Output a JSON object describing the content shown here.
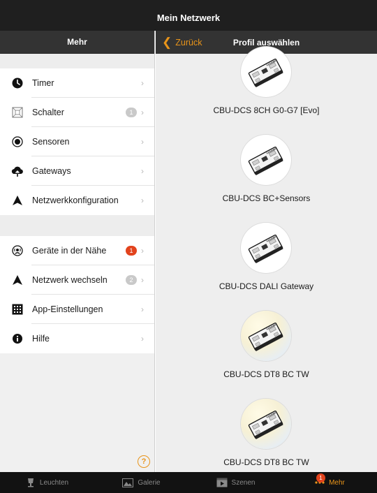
{
  "window": {
    "title": "Mein Netzwerk"
  },
  "left_panel": {
    "header": "Mehr",
    "group1": [
      {
        "label": "Timer",
        "icon": "clock-icon",
        "badge": ""
      },
      {
        "label": "Schalter",
        "icon": "switch-icon",
        "badge": "1",
        "badge_color": "#c9c9c9"
      },
      {
        "label": "Sensoren",
        "icon": "sensor-icon",
        "badge": ""
      },
      {
        "label": "Gateways",
        "icon": "cloud-upload-icon",
        "badge": ""
      },
      {
        "label": "Netzwerkkonfiguration",
        "icon": "network-arrow-icon",
        "badge": ""
      }
    ],
    "group2": [
      {
        "label": "Geräte in der Nähe",
        "icon": "nearby-icon",
        "badge": "1",
        "badge_color": "#e2431d"
      },
      {
        "label": "Netzwerk wechseln",
        "icon": "network-arrow-icon",
        "badge": "2",
        "badge_color": "#c9c9c9"
      },
      {
        "label": "App-Einstellungen",
        "icon": "settings-grid-icon",
        "badge": ""
      },
      {
        "label": "Hilfe",
        "icon": "info-icon",
        "badge": ""
      }
    ],
    "help_symbol": "?"
  },
  "right_panel": {
    "back_label": "Zurück",
    "back_symbol": "❮",
    "title": "Profil auswählen",
    "profiles": [
      {
        "name": "CBU-DCS 8CH G0-G7 [Evo]",
        "variant": "white"
      },
      {
        "name": "CBU-DCS BC+Sensors",
        "variant": "white"
      },
      {
        "name": "CBU-DCS DALI Gateway",
        "variant": "white"
      },
      {
        "name": "CBU-DCS DT8 BC TW",
        "variant": "warm"
      },
      {
        "name": "CBU-DCS DT8 BC TW",
        "variant": "warm"
      }
    ],
    "device_brand_text": "CASAMBI"
  },
  "tabbar": {
    "tabs": [
      {
        "label": "Leuchten",
        "icon": "lamp-icon",
        "active": false
      },
      {
        "label": "Galerie",
        "icon": "gallery-icon",
        "active": false
      },
      {
        "label": "Szenen",
        "icon": "scenes-icon",
        "active": false
      },
      {
        "label": "Mehr",
        "icon": "more-dots-icon",
        "active": true,
        "badge": "1"
      }
    ]
  },
  "colors": {
    "accent": "#e8941a",
    "badge_red": "#e2431d",
    "header_bg": "#333333",
    "tabbar_bg": "#121212"
  }
}
